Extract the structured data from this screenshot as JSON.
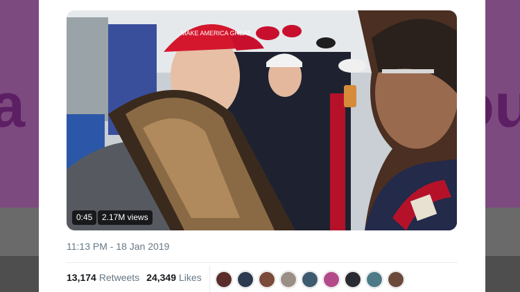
{
  "background": {
    "left_glyph": "a",
    "right_glyph": "ou"
  },
  "tweet": {
    "video": {
      "duration": "0:45",
      "views": "2.17M views",
      "cap_text": "MAKE AMERICA GREAT"
    },
    "timestamp": "11:13 PM - 18 Jan 2019",
    "stats": {
      "retweets_count": "13,174",
      "retweets_label": "Retweets",
      "likes_count": "24,349",
      "likes_label": "Likes"
    },
    "liker_avatars": [
      {
        "name": "avatar-1",
        "color": "#5a2d2a"
      },
      {
        "name": "avatar-2",
        "color": "#2e3a4f"
      },
      {
        "name": "avatar-3",
        "color": "#7a4a3a"
      },
      {
        "name": "avatar-4",
        "color": "#9a8f86"
      },
      {
        "name": "avatar-5",
        "color": "#3e5a6e"
      },
      {
        "name": "avatar-6",
        "color": "#b24a8a"
      },
      {
        "name": "avatar-7",
        "color": "#2a2a33"
      },
      {
        "name": "avatar-8",
        "color": "#4d7a86"
      },
      {
        "name": "avatar-9",
        "color": "#6b4a3b"
      }
    ]
  },
  "colors": {
    "page_bg": "#8a4f8c",
    "card_bg": "#ffffff",
    "secondary_text": "#657786",
    "primary_text": "#14171a"
  }
}
